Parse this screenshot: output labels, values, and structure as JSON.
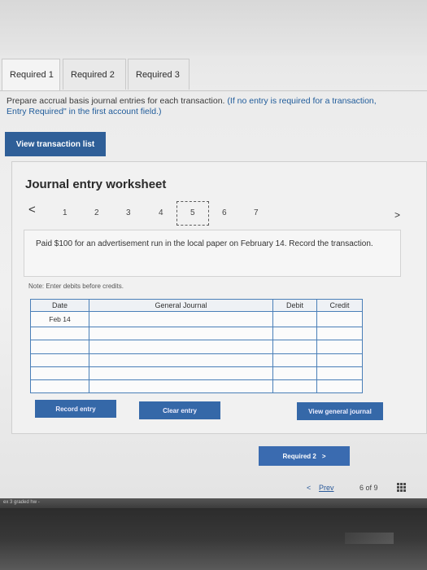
{
  "tabs": [
    {
      "label": "Required 1",
      "active": true
    },
    {
      "label": "Required 2",
      "active": false
    },
    {
      "label": "Required 3",
      "active": false
    }
  ],
  "instructions": {
    "text": "Prepare accrual basis journal entries for each transaction.",
    "highlight": "(If no entry is required for a transaction, select \"No Journal Entry Required\" in the first account field.)",
    "visible_line1_highlight": "(If no entry is required for a transaction,",
    "visible_line2": "Entry Required\" in the first account field.)"
  },
  "view_transaction_list_label": "View transaction list",
  "worksheet": {
    "title": "Journal entry worksheet",
    "nav_prev": "<",
    "nav_next": ">",
    "pages": [
      "1",
      "2",
      "3",
      "4",
      "5",
      "6",
      "7"
    ],
    "current_page": "5",
    "transaction_text": "Paid $100 for an advertisement run in the local paper on February 14. Record the transaction.",
    "note": "Note: Enter debits before credits.",
    "table": {
      "headers": {
        "date": "Date",
        "account": "General Journal",
        "debit": "Debit",
        "credit": "Credit"
      },
      "rows": [
        {
          "date": "Feb 14",
          "account": "",
          "debit": "",
          "credit": ""
        },
        {
          "date": "",
          "account": "",
          "debit": "",
          "credit": ""
        },
        {
          "date": "",
          "account": "",
          "debit": "",
          "credit": ""
        },
        {
          "date": "",
          "account": "",
          "debit": "",
          "credit": ""
        },
        {
          "date": "",
          "account": "",
          "debit": "",
          "credit": ""
        },
        {
          "date": "",
          "account": "",
          "debit": "",
          "credit": ""
        }
      ]
    },
    "buttons": {
      "record": "Record entry",
      "clear": "Clear entry",
      "view_general": "View general journal"
    }
  },
  "footer": {
    "next_required": "Required 2",
    "next_arrow": ">",
    "prev_arrow": "<",
    "prev_label": "Prev",
    "page_indicator": "6 of 9"
  },
  "taskbar_text": "ex 3 graded hw -",
  "colors": {
    "primary_button": "#2f5f98",
    "table_border": "#4a7fb8",
    "instruction_highlight": "#1f5b9a"
  }
}
